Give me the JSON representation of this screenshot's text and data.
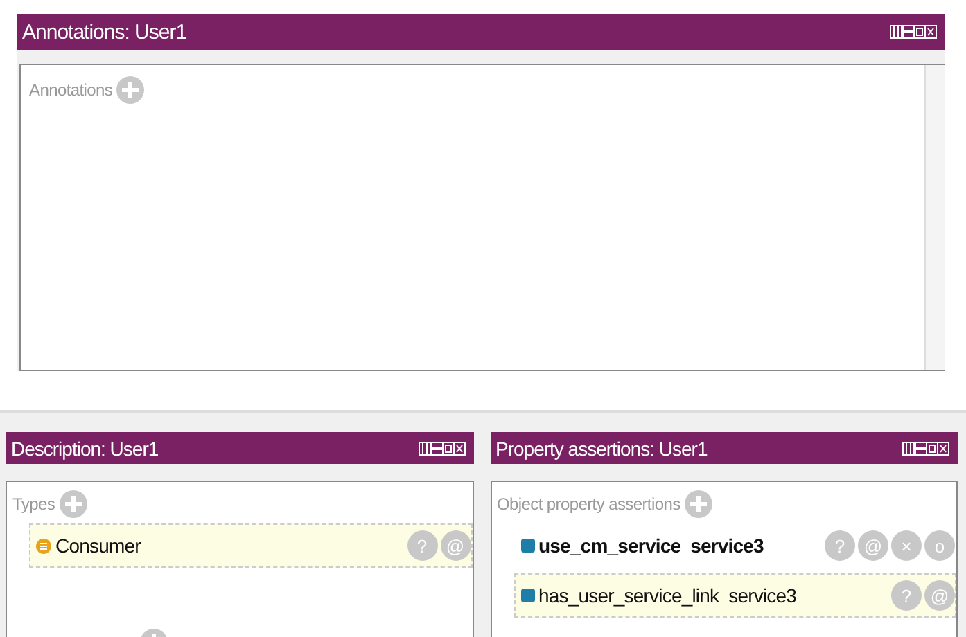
{
  "top_panel": {
    "title": "Annotations: User1",
    "sections": [
      {
        "label": "Annotations"
      }
    ]
  },
  "bottom_panels": [
    {
      "title": "Description: User1",
      "sections": [
        {
          "label": "Types",
          "rows": [
            {
              "text": "Consumer",
              "kind": "class",
              "bold": false,
              "selected": true,
              "actions": [
                "?",
                "@"
              ]
            }
          ]
        }
      ],
      "more_add": true
    },
    {
      "title": "Property assertions: User1",
      "sections": [
        {
          "label": "Object property assertions",
          "rows": [
            {
              "text": "use_cm_service  service3",
              "kind": "property",
              "bold": true,
              "selected": false,
              "actions": [
                "?",
                "@",
                "×",
                "o"
              ]
            },
            {
              "text": "has_user_service_link  service3",
              "kind": "property",
              "bold": false,
              "selected": true,
              "actions": [
                "?",
                "@"
              ]
            }
          ]
        }
      ],
      "more_add": false
    }
  ]
}
